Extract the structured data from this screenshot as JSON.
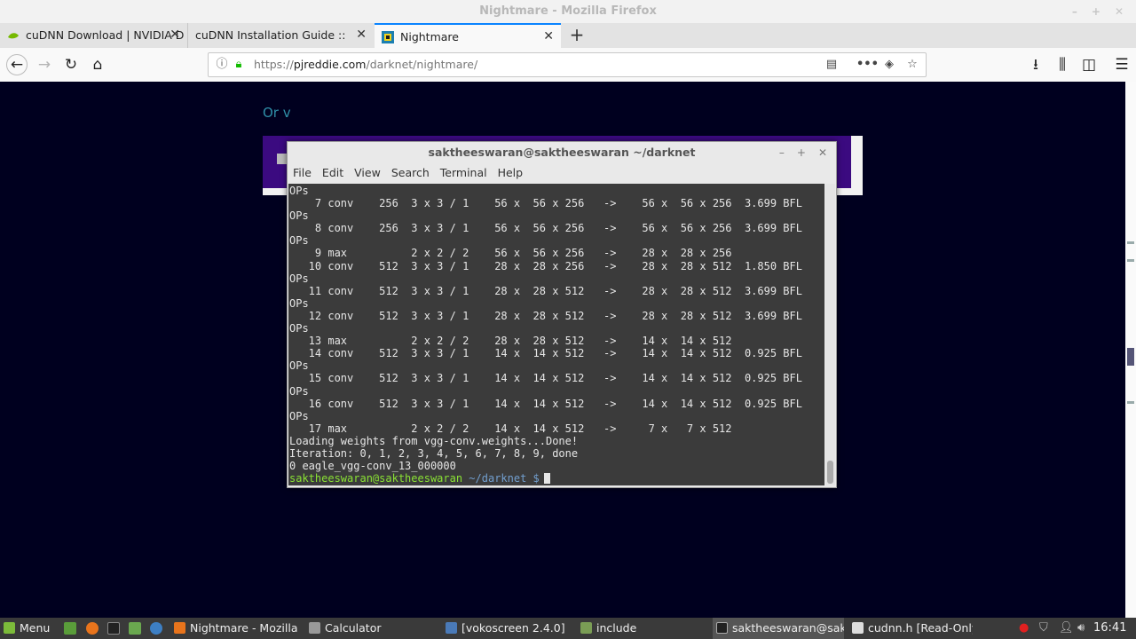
{
  "browser": {
    "window_title": "Nightmare - Mozilla Firefox",
    "tabs": [
      {
        "label": "cuDNN Download | NVIDIA D",
        "favicon": "nvidia-icon",
        "active": false
      },
      {
        "label": "cuDNN Installation Guide :: Deep",
        "favicon": "none",
        "active": false
      },
      {
        "label": "Nightmare",
        "favicon": "nightmare-icon",
        "active": true
      }
    ],
    "url": {
      "prefix": "https://",
      "host": "pjreddie.com",
      "path": "/darknet/nightmare/"
    },
    "page_snippet": "Or v"
  },
  "terminal": {
    "title": "saktheeswaran@saktheeswaran ~/darknet",
    "menu": [
      "File",
      "Edit",
      "View",
      "Search",
      "Terminal",
      "Help"
    ],
    "lines": [
      "OPs",
      "    7 conv    256  3 x 3 / 1    56 x  56 x 256   ->    56 x  56 x 256  3.699 BFL",
      "OPs",
      "    8 conv    256  3 x 3 / 1    56 x  56 x 256   ->    56 x  56 x 256  3.699 BFL",
      "OPs",
      "    9 max          2 x 2 / 2    56 x  56 x 256   ->    28 x  28 x 256",
      "   10 conv    512  3 x 3 / 1    28 x  28 x 256   ->    28 x  28 x 512  1.850 BFL",
      "OPs",
      "   11 conv    512  3 x 3 / 1    28 x  28 x 512   ->    28 x  28 x 512  3.699 BFL",
      "OPs",
      "   12 conv    512  3 x 3 / 1    28 x  28 x 512   ->    28 x  28 x 512  3.699 BFL",
      "OPs",
      "   13 max          2 x 2 / 2    28 x  28 x 512   ->    14 x  14 x 512",
      "   14 conv    512  3 x 3 / 1    14 x  14 x 512   ->    14 x  14 x 512  0.925 BFL",
      "OPs",
      "   15 conv    512  3 x 3 / 1    14 x  14 x 512   ->    14 x  14 x 512  0.925 BFL",
      "OPs",
      "   16 conv    512  3 x 3 / 1    14 x  14 x 512   ->    14 x  14 x 512  0.925 BFL",
      "OPs",
      "   17 max          2 x 2 / 2    14 x  14 x 512   ->     7 x   7 x 512",
      "Loading weights from vgg-conv.weights...Done!",
      "Iteration: 0, 1, 2, 3, 4, 5, 6, 7, 8, 9, done",
      "0 eagle_vgg-conv_13_000000"
    ],
    "prompt_user": "saktheeswaran@saktheeswaran",
    "prompt_dir": " ~/darknet $"
  },
  "taskbar": {
    "menu_label": "Menu",
    "windows": [
      {
        "label": "Nightmare - Mozilla ...",
        "icon": "firefox-icon"
      },
      {
        "label": "Calculator",
        "icon": "calculator-icon"
      },
      {
        "label": "[vokoscreen 2.4.0]",
        "icon": "vokoscreen-icon"
      },
      {
        "label": "include",
        "icon": "folder-icon"
      },
      {
        "label": "saktheeswaran@sak...",
        "icon": "terminal-icon"
      },
      {
        "label": "cudnn.h [Read-Only] ...",
        "icon": "text-editor-icon"
      }
    ],
    "clock": "16:41"
  },
  "colors": {
    "page_background": "#00001f",
    "terminal_background": "#3b3b3b",
    "prompt_user": "#8ae234",
    "prompt_dir": "#729fcf",
    "tab_accent": "#0a84ff"
  }
}
